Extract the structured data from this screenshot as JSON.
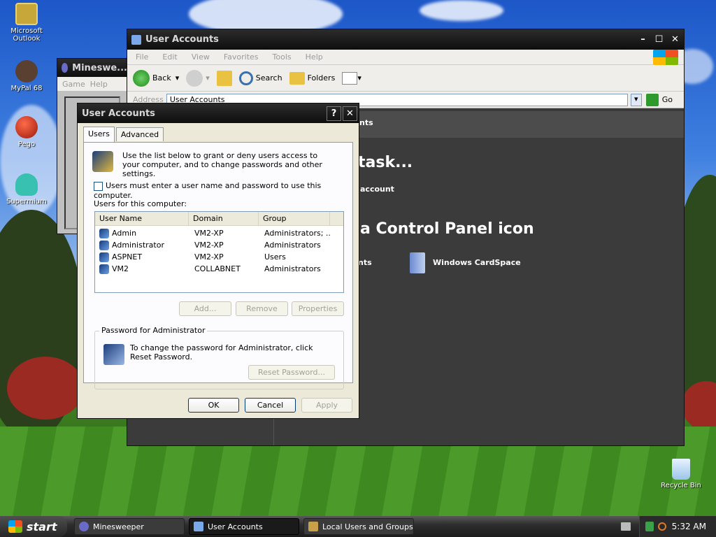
{
  "desktop": {
    "icons": [
      {
        "label": "Microsoft Outlook"
      },
      {
        "label": "MyPal 68"
      },
      {
        "label": "Pego"
      },
      {
        "label": "Supermium"
      },
      {
        "label": "Recycle Bin"
      }
    ]
  },
  "explorer": {
    "title": "User Accounts",
    "menu": [
      "File",
      "Edit",
      "View",
      "Favorites",
      "Tools",
      "Help"
    ],
    "toolbar": {
      "back": "Back",
      "search": "Search",
      "folders": "Folders"
    },
    "address_label": "Address",
    "address_value": "User Accounts",
    "go": "Go",
    "header_partial": "nts",
    "pick_task": "task...",
    "task_partial": "account",
    "pick_icon": "a Control Panel icon",
    "icon_partial": "nts",
    "cardspace": "Windows CardSpace"
  },
  "minesweeper": {
    "title": "Mineswe...",
    "menu": [
      "Game",
      "Help"
    ]
  },
  "dialog": {
    "title": "User Accounts",
    "help_btn": "?",
    "close_btn": "✕",
    "tabs": [
      "Users",
      "Advanced"
    ],
    "intro": "Use the list below to grant or deny users access to your computer, and to change passwords and other settings.",
    "checkbox_label": "Users must enter a user name and password to use this computer.",
    "list_label": "Users for this computer:",
    "columns": [
      "User Name",
      "Domain",
      "Group"
    ],
    "users": [
      {
        "name": "Admin",
        "domain": "VM2-XP",
        "group": "Administrators; ..."
      },
      {
        "name": "Administrator",
        "domain": "VM2-XP",
        "group": "Administrators"
      },
      {
        "name": "ASPNET",
        "domain": "VM2-XP",
        "group": "Users"
      },
      {
        "name": "VM2",
        "domain": "COLLABNET",
        "group": "Administrators"
      }
    ],
    "add_btn": "Add...",
    "remove_btn": "Remove",
    "properties_btn": "Properties",
    "password_group": "Password for Administrator",
    "password_text": "To change the password for Administrator, click Reset Password.",
    "reset_btn": "Reset Password...",
    "ok": "OK",
    "cancel": "Cancel",
    "apply": "Apply"
  },
  "taskbar": {
    "start": "start",
    "tasks": [
      "Minesweeper",
      "User Accounts",
      "Local Users and Groups"
    ],
    "clock": "5:32 AM"
  }
}
